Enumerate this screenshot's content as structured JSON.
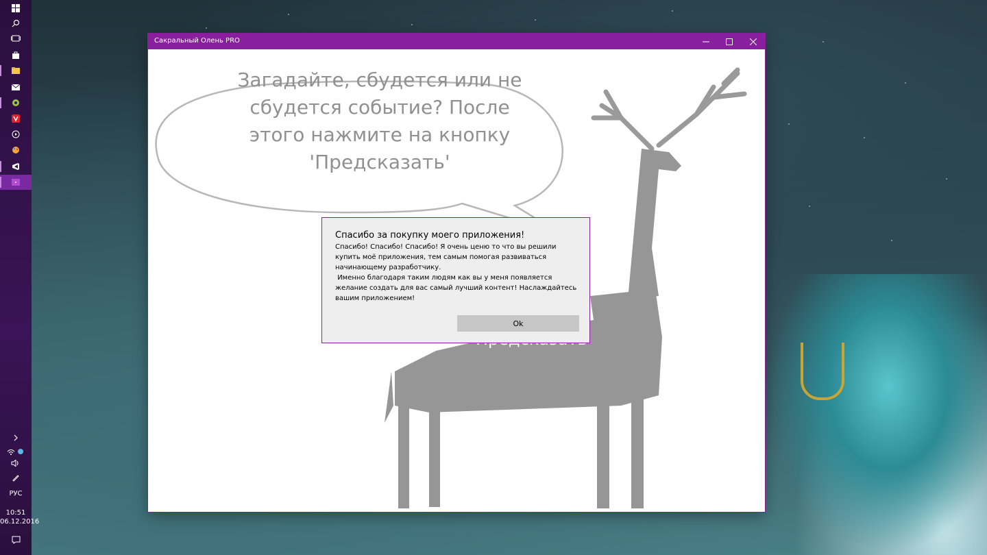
{
  "window": {
    "title": "Сакральный Олень PRO",
    "accent_color": "#8a1f9e",
    "minimize_icon": "minimize-icon",
    "maximize_icon": "maximize-icon",
    "close_icon": "close-icon"
  },
  "bubble": {
    "text": "Загадайте, сбудется или не сбудется событие? После этого нажмите на кнопку 'Предсказать'"
  },
  "predict_button": {
    "label": "Предсказать"
  },
  "dialog": {
    "title": "Спасибо за покупку моего приложения!",
    "body": "Спасибо! Спасибо! Спасибо! Я очень ценю то что вы решили купить моё приложения, тем самым помогая развиваться начинающему разработчику.\n Именно благодаря таким людям как вы у меня появляется желание создать для вас самый лучший контент! Наслаждайтесь вашим приложением!",
    "ok_label": "Ok"
  },
  "taskbar": {
    "accent_color": "#7a2aa0",
    "language": "РУС",
    "time": "10:51",
    "date": "06.12.2016"
  }
}
